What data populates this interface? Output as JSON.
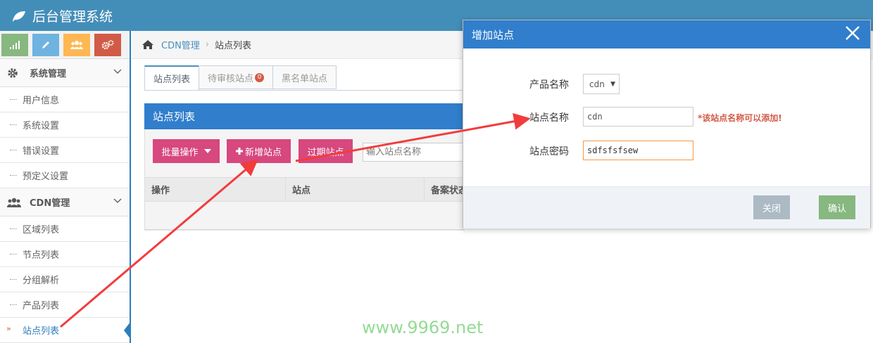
{
  "app": {
    "title": "后台管理系统"
  },
  "colors": {
    "navbar": "#438eb9",
    "primary": "#307ecc",
    "pink": "#d6487e",
    "green": "#87b87f",
    "grey": "#abbac3",
    "danger": "#d15b47"
  },
  "shortcuts": [
    "signal-icon",
    "pencil-icon",
    "users-icon",
    "cogs-icon"
  ],
  "sidebar": {
    "groups": [
      {
        "label": "系统管理",
        "icon": "gear-icon",
        "items": [
          "用户信息",
          "系统设置",
          "错误设置",
          "预定义设置"
        ]
      },
      {
        "label": "CDN管理",
        "icon": "users-icon",
        "items": [
          "区域列表",
          "节点列表",
          "分组解析",
          "产品列表",
          "站点列表"
        ]
      }
    ],
    "active_item": "站点列表"
  },
  "breadcrumb": {
    "section": "CDN管理",
    "page": "站点列表"
  },
  "tabs": [
    {
      "label": "站点列表",
      "active": true
    },
    {
      "label": "待审核站点",
      "badge": "0"
    },
    {
      "label": "黑名单站点"
    }
  ],
  "panel": {
    "title": "站点列表",
    "batch_label": "批量操作",
    "add_label": "新增站点",
    "expired_label": "过期站点",
    "search_placeholder": "输入站点名称",
    "columns": [
      "操作",
      "站点",
      "备案状态"
    ]
  },
  "modal": {
    "title": "增加站点",
    "fields": {
      "product": {
        "label": "产品名称",
        "value": "cdn"
      },
      "site_name": {
        "label": "站点名称",
        "value": "cdn",
        "hint": "*该站点名称可以添加!"
      },
      "site_password": {
        "label": "站点密码",
        "value": "sdfsfsfsew"
      }
    },
    "close_label": "关闭",
    "confirm_label": "确认"
  },
  "watermark": "www.9969.net"
}
